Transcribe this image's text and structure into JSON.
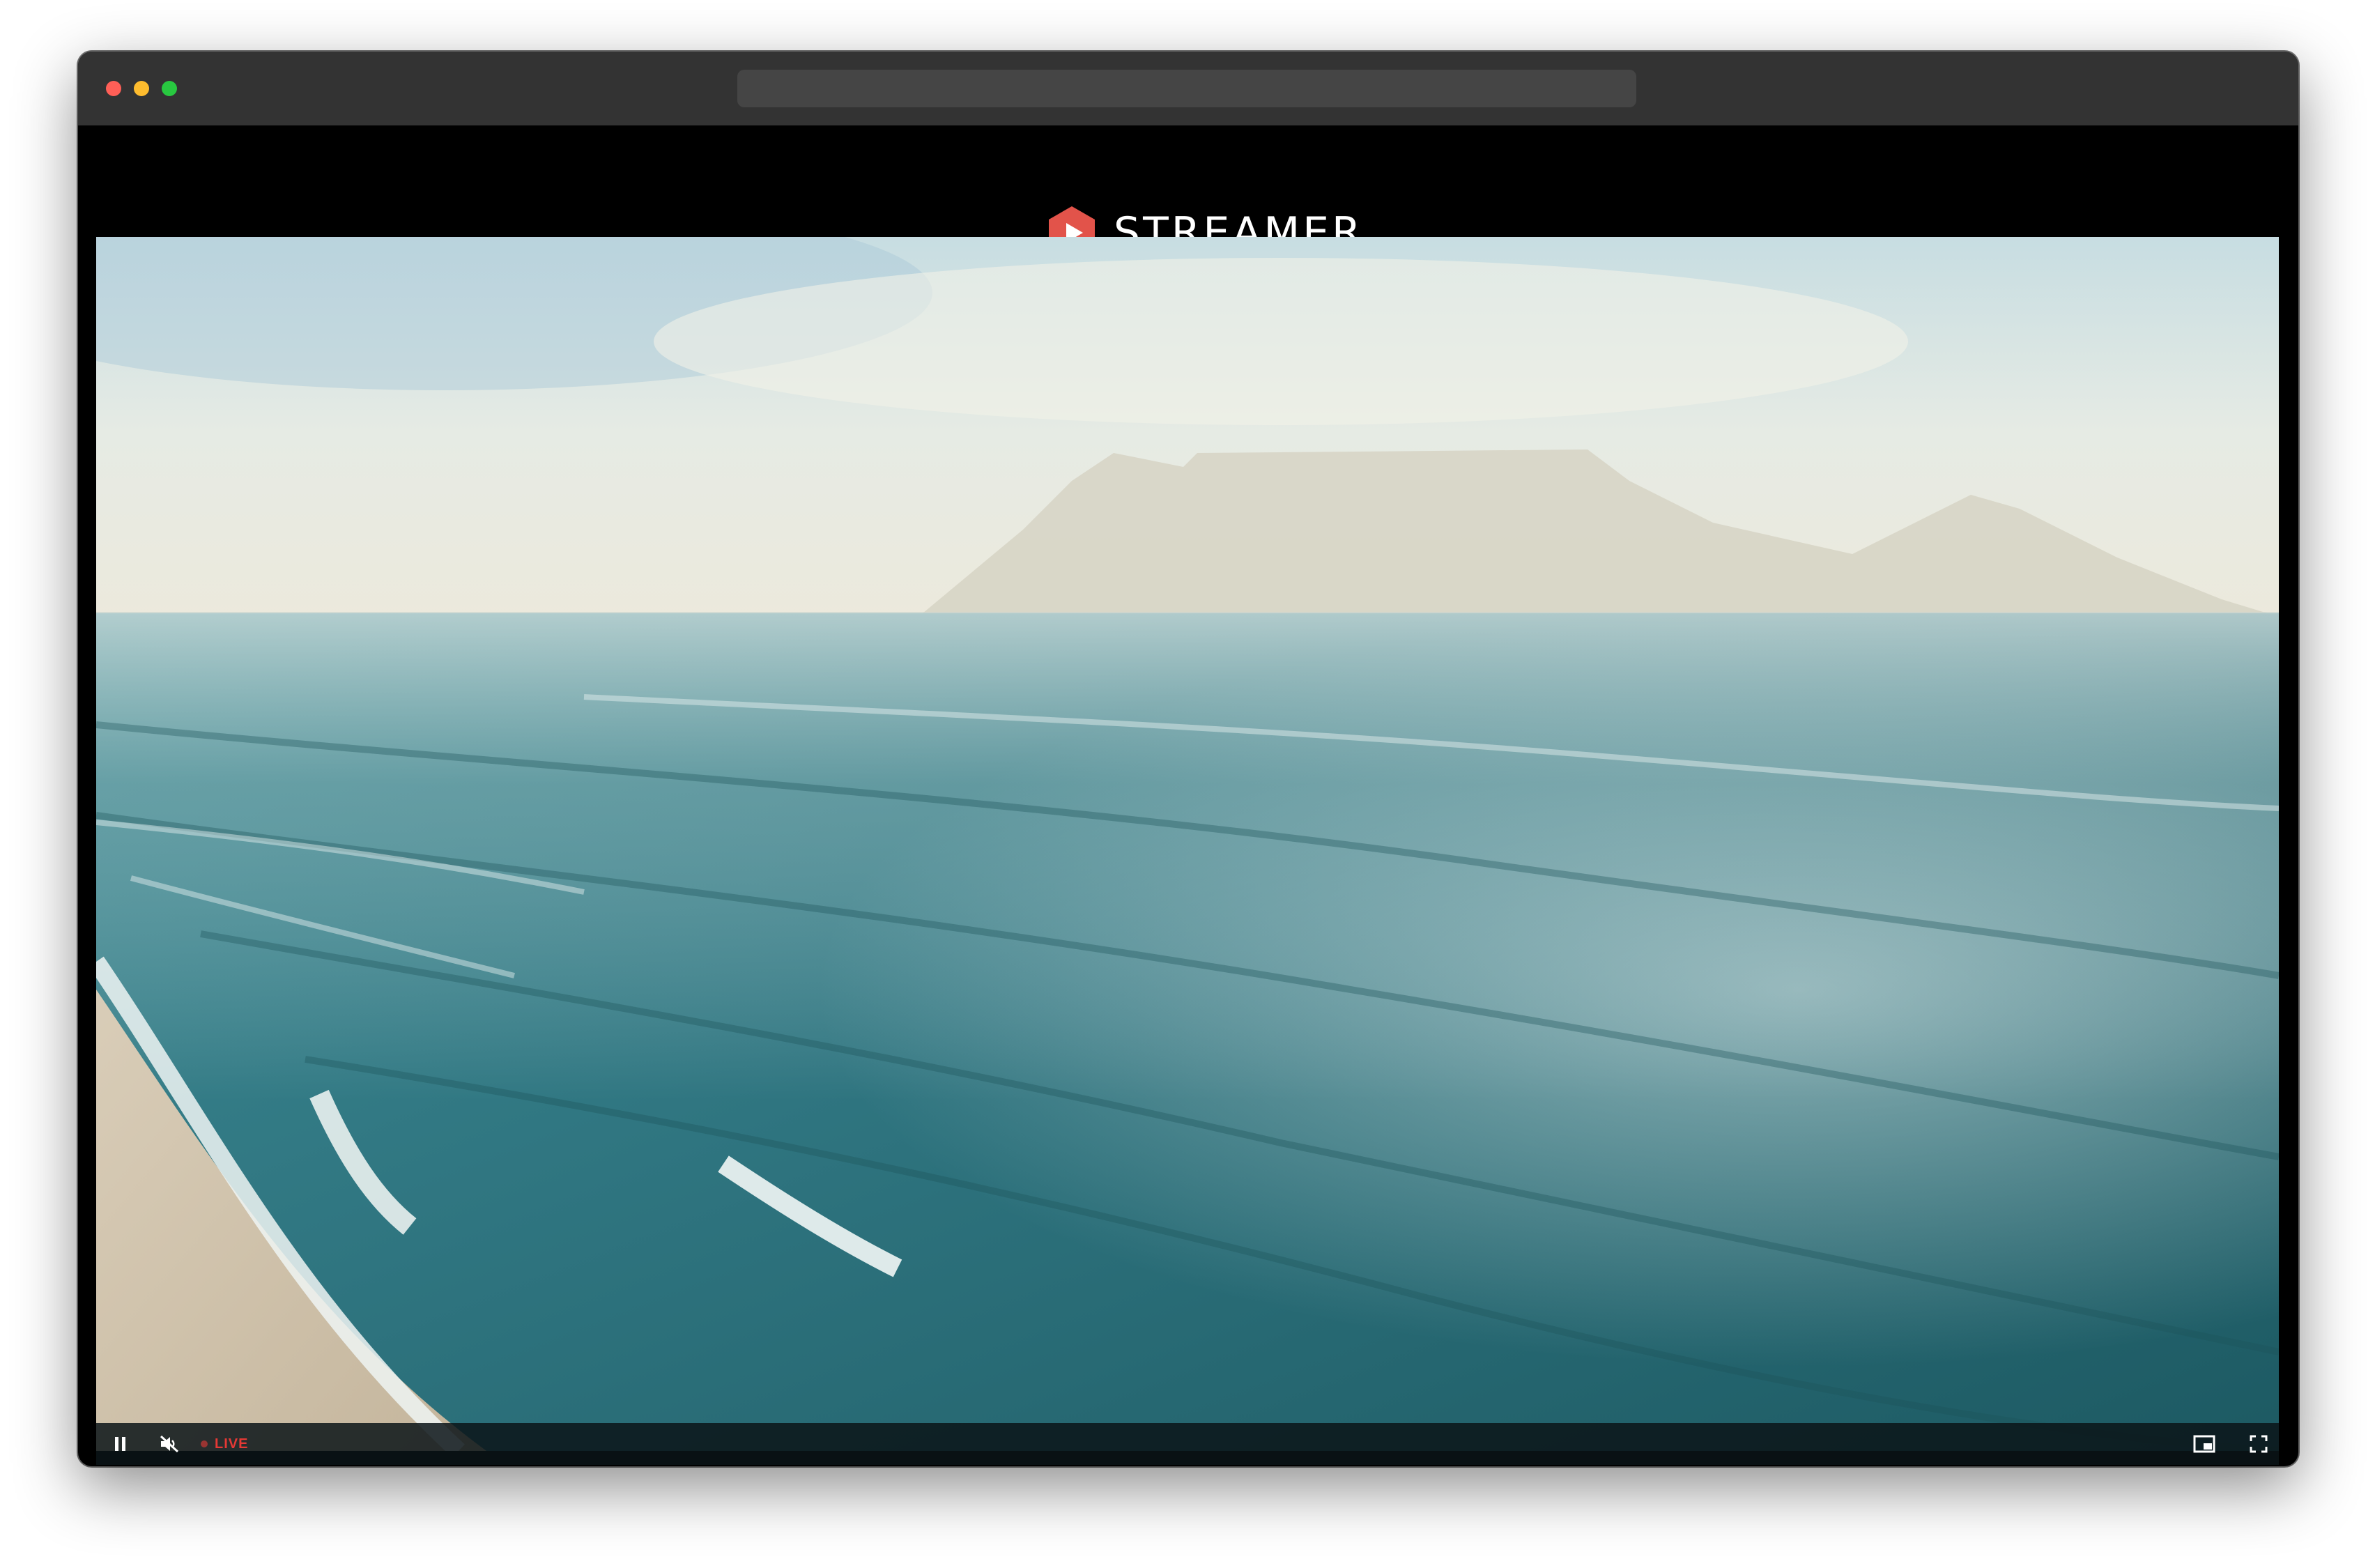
{
  "app": {
    "name": "STREAMER",
    "accent": "#e2534a"
  },
  "window": {
    "controls": [
      "close",
      "minimize",
      "zoom"
    ]
  },
  "player": {
    "status_label": "LIVE",
    "status_color": "#e53935",
    "controls": {
      "play_pause_icon": "pause-icon",
      "mute_icon": "muted-speaker-icon",
      "pip_icon": "picture-in-picture-icon",
      "fullscreen_icon": "fullscreen-icon"
    }
  }
}
